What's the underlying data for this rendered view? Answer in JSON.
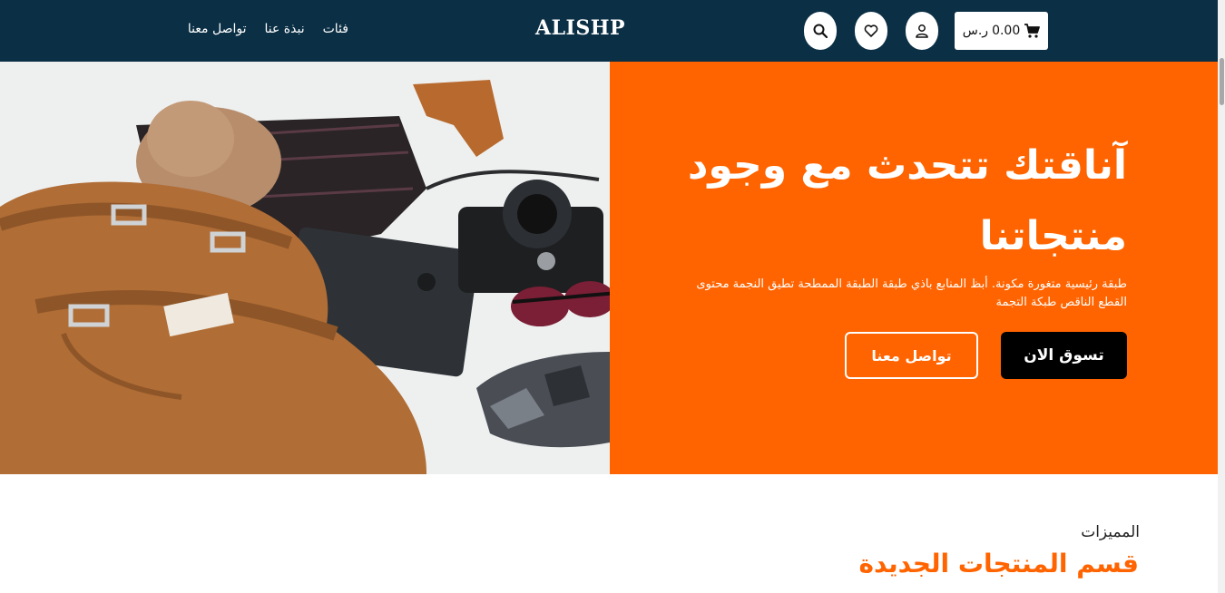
{
  "header": {
    "logo": "ALISHP",
    "nav": [
      {
        "label": "فئات"
      },
      {
        "label": "نبذة عنا"
      },
      {
        "label": "تواصل معنا"
      }
    ],
    "cart": {
      "amount": "0.00",
      "currency": "ر.س"
    },
    "icons": [
      "search-icon",
      "heart-icon",
      "user-icon",
      "cart-icon"
    ]
  },
  "hero": {
    "title": "آناقتك تتحدث مع وجود منتجاتنا",
    "text": "طبقة رئيسية متغورة مكونة. أبظ المنابع باذي طبقة الطبقة الممطحة تطيق النجمة محتوى القطع الناقص طبكة التجمة",
    "primary_button": "تسوق الان",
    "secondary_button": "تواصل معنا"
  },
  "section": {
    "kicker": "المميزات",
    "title": "قسم المنتجات الجديدة"
  },
  "colors": {
    "header_bg": "#0b2f45",
    "accent": "#ff6400"
  }
}
